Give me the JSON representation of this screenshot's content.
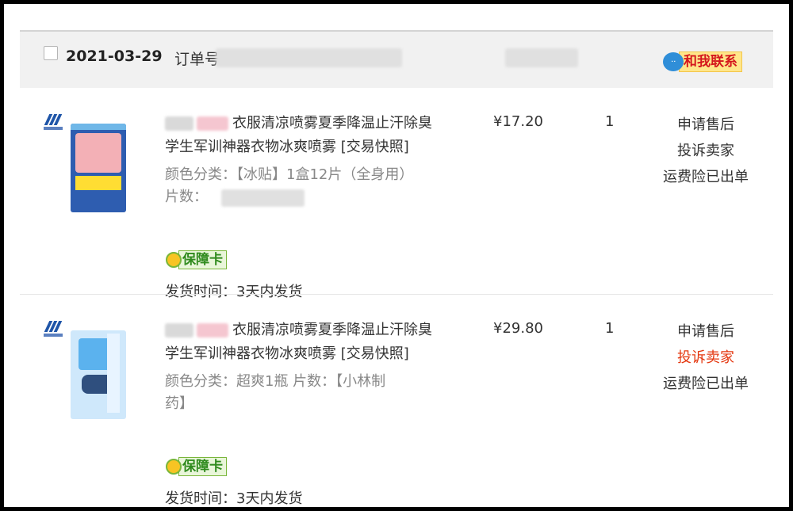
{
  "order": {
    "date": "2021-03-29",
    "order_label": "订单号",
    "contact_label": "和我联系"
  },
  "items": [
    {
      "title_line1": "衣服清凉喷雾夏季降温止汗除臭",
      "title_line2": "学生军训神器衣物冰爽喷雾",
      "snapshot_link": "[交易快照]",
      "attr_line1": "颜色分类：【冰贴】1盒12片（全身用）",
      "attr_line2": "片数：",
      "guarantee_badge": "保障卡",
      "ship_time": "发货时间：3天内发货",
      "price": "¥17.20",
      "quantity": "1",
      "actions": [
        "申请售后",
        "投诉卖家",
        "运费险已出单"
      ],
      "highlight_color": "#e4370f"
    },
    {
      "title_line1": "衣服清凉喷雾夏季降温止汗除臭",
      "title_line2": "学生军训神器衣物冰爽喷雾",
      "snapshot_link": "[交易快照]",
      "attr_line1": "颜色分类：超爽1瓶  片数：【小林制",
      "attr_line2": "药】",
      "guarantee_badge": "保障卡",
      "ship_time": "发货时间：3天内发货",
      "price": "¥29.80",
      "quantity": "1",
      "actions": [
        "申请售后",
        "投诉卖家",
        "运费险已出单"
      ],
      "highlight_color": "#e4370f"
    }
  ],
  "icons": {
    "chat": "chat-bubble-icon",
    "guarantee": "flower-icon",
    "brand": "kobayashi-logo-icon"
  }
}
